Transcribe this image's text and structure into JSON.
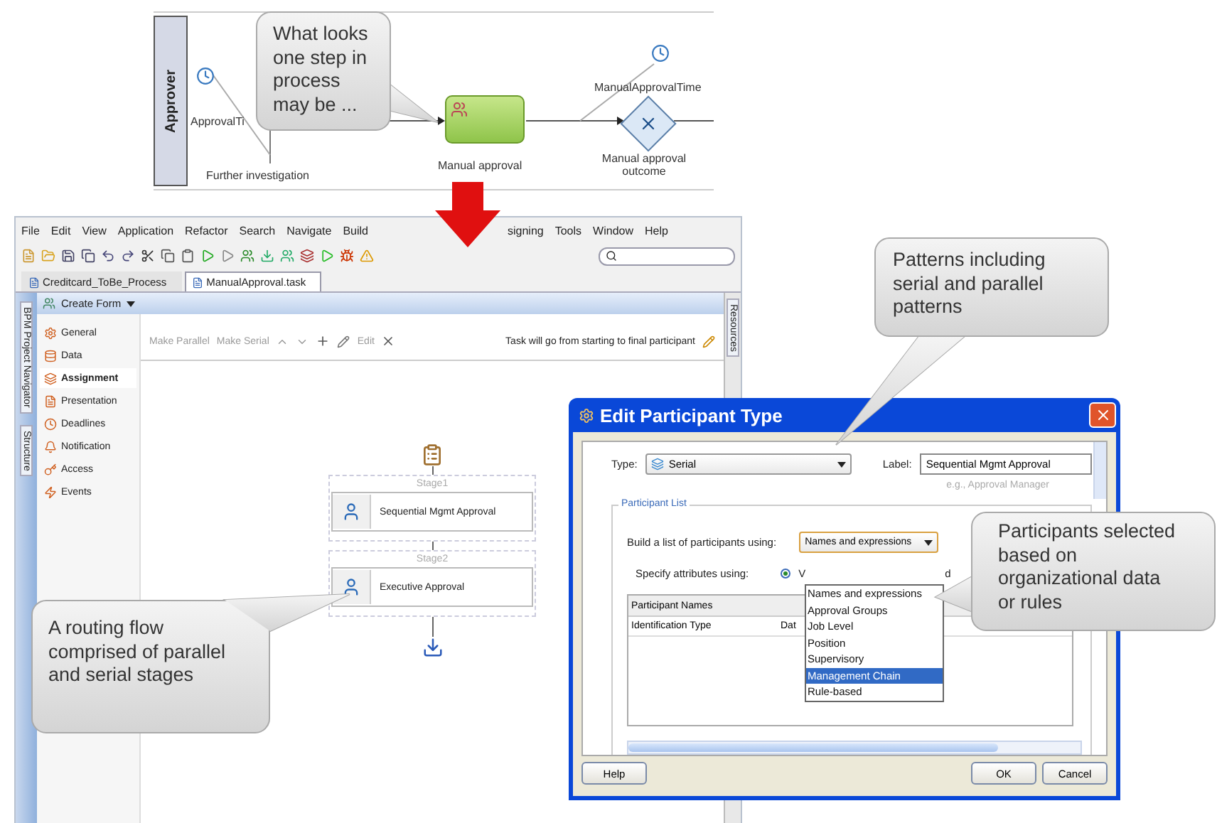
{
  "process_diagram": {
    "lane": "Approver",
    "timer_labels": [
      "ApprovalTi",
      "ManualApprovalTime"
    ],
    "path_label": "Further investigation",
    "task": "Manual approval",
    "gateway": "Manual approval outcome"
  },
  "callouts": [
    {
      "text": "What looks one step in process may be ..."
    },
    {
      "text": "A routing flow comprised of parallel and serial stages"
    },
    {
      "text": "Patterns including serial and parallel patterns"
    },
    {
      "text": "Participants selected based on organizational data or rules"
    }
  ],
  "ide": {
    "menu": [
      "File",
      "Edit",
      "View",
      "Application",
      "Refactor",
      "Search",
      "Navigate",
      "Build",
      "signing",
      "Tools",
      "Window",
      "Help"
    ],
    "tabs": [
      {
        "label": "Creditcard_ToBe_Process",
        "selected": false
      },
      {
        "label": "ManualApproval.task",
        "selected": true
      }
    ],
    "create_form": "Create Form",
    "side_tabs": [
      "BPM Project Navigator",
      "Structure"
    ],
    "right_tab": "Resources",
    "nav": [
      {
        "label": "General",
        "selected": false
      },
      {
        "label": "Data",
        "selected": false
      },
      {
        "label": "Assignment",
        "selected": true
      },
      {
        "label": "Presentation",
        "selected": false
      },
      {
        "label": "Deadlines",
        "selected": false
      },
      {
        "label": "Notification",
        "selected": false
      },
      {
        "label": "Access",
        "selected": false
      },
      {
        "label": "Events",
        "selected": false
      }
    ],
    "toolbar": {
      "make_parallel": "Make Parallel",
      "make_serial": "Make Serial",
      "edit": "Edit",
      "hint": "Task will go from starting to final participant"
    },
    "stages": [
      {
        "label": "Stage1",
        "participant": "Sequential Mgmt Approval"
      },
      {
        "label": "Stage2",
        "participant": "Executive Approval"
      }
    ]
  },
  "dialog": {
    "title": "Edit Participant Type",
    "type_label": "Type:",
    "type_value": "Serial",
    "label_label": "Label:",
    "label_value": "Sequential Mgmt Approval",
    "label_hint": "e.g., Approval Manager",
    "group": "Participant List",
    "build_label": "Build a list of participants using:",
    "build_value": "Names and expressions",
    "options": [
      {
        "label": "Names and expressions",
        "selected": false
      },
      {
        "label": "Approval Groups",
        "selected": false
      },
      {
        "label": "Job Level",
        "selected": false
      },
      {
        "label": "Position",
        "selected": false
      },
      {
        "label": "Supervisory",
        "selected": false
      },
      {
        "label": "Management Chain",
        "selected": true
      },
      {
        "label": "Rule-based",
        "selected": false
      }
    ],
    "attributes_label": "Specify attributes using:",
    "attribute_option": {
      "label": "V",
      "selected": true
    },
    "attribute_tail": "d",
    "table": {
      "header": "Participant Names",
      "rows": [
        [
          "Identification Type",
          "Dat"
        ]
      ]
    },
    "buttons": [
      "Help",
      "OK",
      "Cancel"
    ]
  }
}
